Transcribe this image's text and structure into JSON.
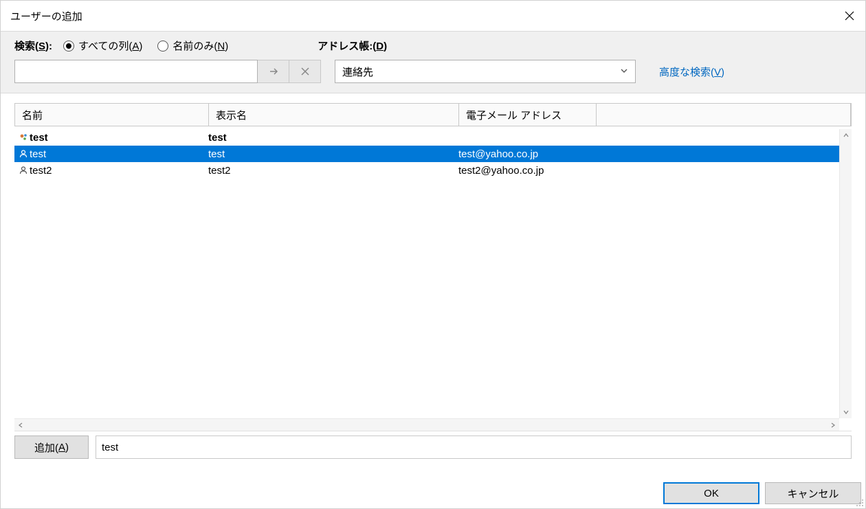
{
  "title": "ユーザーの追加",
  "search": {
    "label_prefix": "検索(",
    "label_mn": "S",
    "label_suffix": "):",
    "radio_all_prefix": "すべての列(",
    "radio_all_mn": "A",
    "radio_all_suffix": ")",
    "radio_name_prefix": "名前のみ(",
    "radio_name_mn": "N",
    "radio_name_suffix": ")",
    "value": ""
  },
  "addressbook": {
    "label_prefix": "アドレス帳:(",
    "label_mn": "D",
    "label_suffix": ")",
    "selected": "連絡先"
  },
  "advanced_search": {
    "prefix": "高度な検索(",
    "mn": "V",
    "suffix": ")"
  },
  "columns": {
    "name": "名前",
    "display": "表示名",
    "email": "電子メール アドレス"
  },
  "rows": [
    {
      "type": "group",
      "name": "test",
      "display": "test",
      "email": ""
    },
    {
      "type": "contact",
      "selected": true,
      "name": "test",
      "display": "test",
      "email": "test@yahoo.co.jp"
    },
    {
      "type": "contact",
      "selected": false,
      "name": "test2",
      "display": "test2",
      "email": "test2@yahoo.co.jp"
    }
  ],
  "add": {
    "button_prefix": "追加(",
    "button_mn": "A",
    "button_suffix": ")",
    "value": "test"
  },
  "footer": {
    "ok": "OK",
    "cancel": "キャンセル"
  }
}
